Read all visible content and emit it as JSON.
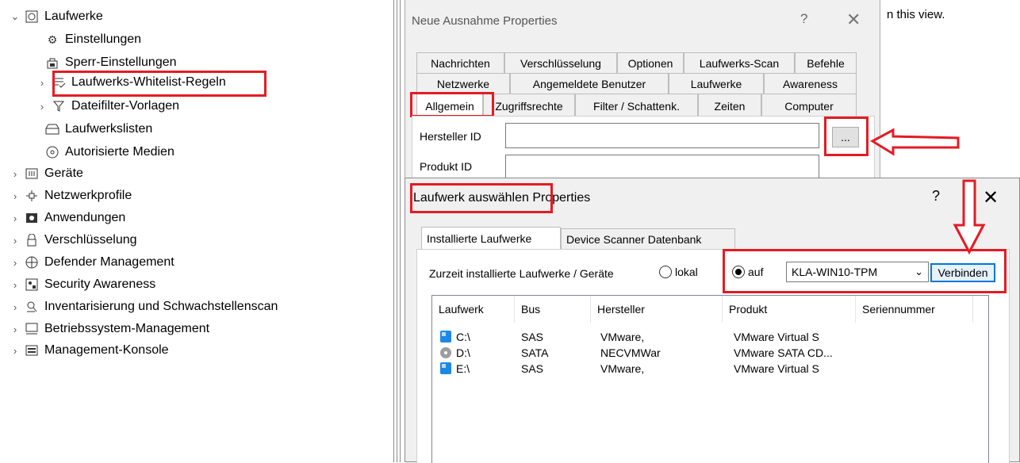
{
  "tree": {
    "items": [
      {
        "label": "Laufwerke",
        "icon": "drive-icon",
        "chev": "⌄"
      },
      {
        "label": "Einstellungen",
        "icon": "gear-icon",
        "chev": ""
      },
      {
        "label": "Sperr-Einstellungen",
        "icon": "lock-icon",
        "chev": ""
      },
      {
        "label": "Laufwerks-Whitelist-Regeln",
        "icon": "list-check-icon",
        "chev": "›"
      },
      {
        "label": "Dateifilter-Vorlagen",
        "icon": "filter-icon",
        "chev": "›"
      },
      {
        "label": "Laufwerkslisten",
        "icon": "tray-icon",
        "chev": ""
      },
      {
        "label": "Autorisierte Medien",
        "icon": "disc-icon",
        "chev": ""
      },
      {
        "label": "Geräte",
        "icon": "device-icon",
        "chev": "›"
      },
      {
        "label": "Netzwerkprofile",
        "icon": "network-icon",
        "chev": "›"
      },
      {
        "label": "Anwendungen",
        "icon": "app-icon",
        "chev": "›"
      },
      {
        "label": "Verschlüsselung",
        "icon": "lock-icon",
        "chev": "›"
      },
      {
        "label": "Defender Management",
        "icon": "shield-icon",
        "chev": "›"
      },
      {
        "label": "Security Awareness",
        "icon": "awareness-icon",
        "chev": "›"
      },
      {
        "label": "Inventarisierung und Schwachstellenscan",
        "icon": "inventory-icon",
        "chev": "›"
      },
      {
        "label": "Betriebssystem-Management",
        "icon": "monitor-icon",
        "chev": "›"
      },
      {
        "label": "Management-Konsole",
        "icon": "console-icon",
        "chev": "›"
      }
    ]
  },
  "peek_text": "n this view.",
  "dialog1": {
    "title": "Neue Ausnahme Properties",
    "help": "?",
    "close": "✕",
    "tabs_row1": [
      "Nachrichten",
      "Verschlüsselung",
      "Optionen",
      "Laufwerks-Scan",
      "Befehle"
    ],
    "tabs_row2": [
      "Netzwerke",
      "Angemeldete Benutzer",
      "Laufwerke",
      "Awareness"
    ],
    "tabs_row3": [
      "Allgemein",
      "Zugriffsrechte",
      "Filter / Schattenk.",
      "Zeiten",
      "Computer"
    ],
    "vendor_label": "Hersteller ID",
    "product_label": "Produkt ID",
    "dots_label": "..."
  },
  "dialog2": {
    "title_part1": "Laufwerk auswählen",
    "title_part2": " Properties",
    "help": "?",
    "close": "✕",
    "tabs": [
      "Installierte Laufwerke",
      "Device Scanner Datenbank"
    ],
    "installed_label": "Zurzeit installierte Laufwerke / Geräte",
    "radio_local": "lokal",
    "radio_on": "auf",
    "host_value": "KLA-WIN10-TPM",
    "connect_label": "Verbinden",
    "columns": [
      "Laufwerk",
      "Bus",
      "Hersteller",
      "Produkt",
      "Seriennummer"
    ],
    "rows": [
      {
        "drive": "C:\\",
        "bus": "SAS",
        "vendor": "VMware,",
        "product": "VMware Virtual S",
        "serial": "",
        "icon": "disk-icon"
      },
      {
        "drive": "D:\\",
        "bus": "SATA",
        "vendor": "NECVMWar",
        "product": "VMware SATA CD...",
        "serial": "",
        "icon": "cd-icon"
      },
      {
        "drive": "E:\\",
        "bus": "SAS",
        "vendor": "VMware,",
        "product": "VMware Virtual S",
        "serial": "",
        "icon": "disk-icon"
      }
    ]
  },
  "colors": {
    "highlight": "#e41b23",
    "accent": "#0078d7"
  }
}
